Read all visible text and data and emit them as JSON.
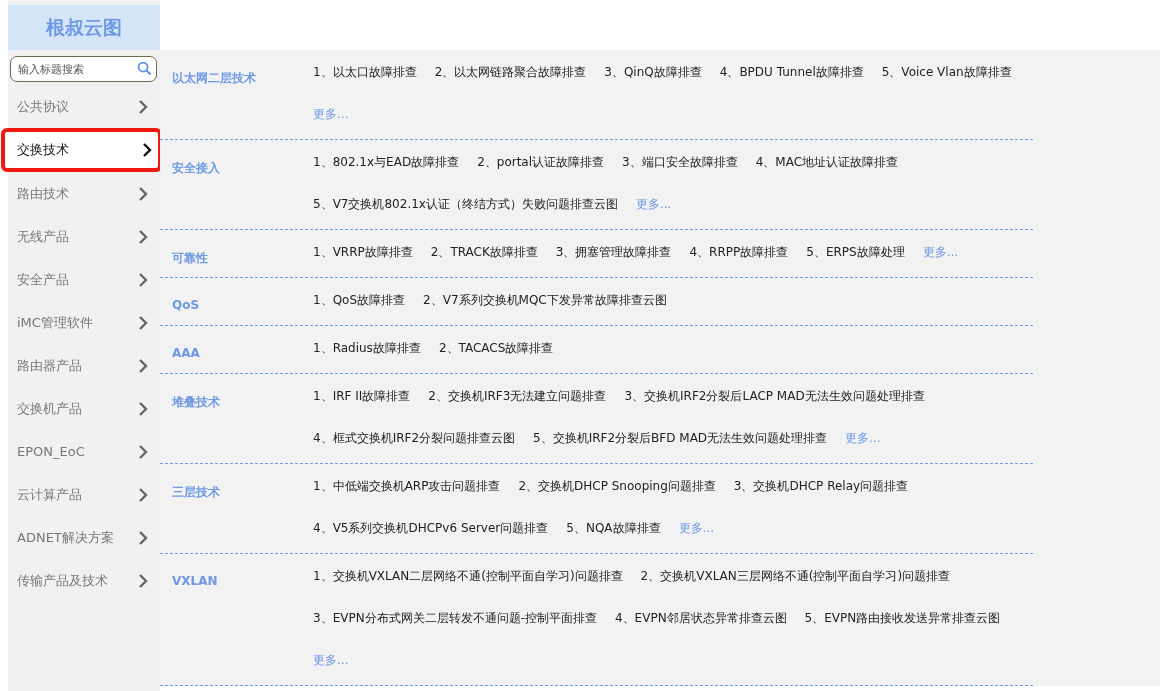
{
  "brand": {
    "title": "根叔云图"
  },
  "search": {
    "placeholder": "输入标题搜索"
  },
  "sidebar": {
    "items": [
      {
        "label": "公共协议",
        "selected": false
      },
      {
        "label": "交换技术",
        "selected": true
      },
      {
        "label": "路由技术",
        "selected": false
      },
      {
        "label": "无线产品",
        "selected": false
      },
      {
        "label": "安全产品",
        "selected": false
      },
      {
        "label": "iMC管理软件",
        "selected": false
      },
      {
        "label": "路由器产品",
        "selected": false
      },
      {
        "label": "交换机产品",
        "selected": false
      },
      {
        "label": "EPON_EoC",
        "selected": false
      },
      {
        "label": "云计算产品",
        "selected": false
      },
      {
        "label": "ADNET解决方案",
        "selected": false
      },
      {
        "label": "传输产品及技术",
        "selected": false
      }
    ]
  },
  "sections": [
    {
      "title": "以太网二层技术",
      "lines": [
        [
          {
            "kind": "article",
            "text": "1、以太口故障排查"
          },
          {
            "kind": "article",
            "text": "2、以太网链路聚合故障排查"
          },
          {
            "kind": "article",
            "text": "3、QinQ故障排查"
          },
          {
            "kind": "article",
            "text": "4、BPDU Tunnel故障排查"
          },
          {
            "kind": "article",
            "text": "5、Voice Vlan故障排查"
          }
        ],
        [
          {
            "kind": "more",
            "text": "更多..."
          }
        ]
      ]
    },
    {
      "title": "安全接入",
      "lines": [
        [
          {
            "kind": "article",
            "text": "1、802.1x与EAD故障排查"
          },
          {
            "kind": "article",
            "text": "2、portal认证故障排查"
          },
          {
            "kind": "article",
            "text": "3、端口安全故障排查"
          },
          {
            "kind": "article",
            "text": "4、MAC地址认证故障排查"
          }
        ],
        [
          {
            "kind": "article",
            "text": "5、V7交换机802.1x认证（终结方式）失败问题排查云图"
          },
          {
            "kind": "more",
            "text": "更多..."
          }
        ]
      ]
    },
    {
      "title": "可靠性",
      "lines": [
        [
          {
            "kind": "article",
            "text": "1、VRRP故障排查"
          },
          {
            "kind": "article",
            "text": "2、TRACK故障排查"
          },
          {
            "kind": "article",
            "text": "3、拥塞管理故障排查"
          },
          {
            "kind": "article",
            "text": "4、RRPP故障排查"
          },
          {
            "kind": "article",
            "text": "5、ERPS故障处理"
          },
          {
            "kind": "more",
            "text": "更多..."
          }
        ]
      ]
    },
    {
      "title": "QoS",
      "lines": [
        [
          {
            "kind": "article",
            "text": "1、QoS故障排查"
          },
          {
            "kind": "article",
            "text": "2、V7系列交换机MQC下发异常故障排查云图"
          }
        ]
      ]
    },
    {
      "title": "AAA",
      "lines": [
        [
          {
            "kind": "article",
            "text": "1、Radius故障排查"
          },
          {
            "kind": "article",
            "text": "2、TACACS故障排查"
          }
        ]
      ]
    },
    {
      "title": "堆叠技术",
      "lines": [
        [
          {
            "kind": "article",
            "text": "1、IRF II故障排查"
          },
          {
            "kind": "article",
            "text": "2、交换机IRF3无法建立问题排查"
          },
          {
            "kind": "article",
            "text": "3、交换机IRF2分裂后LACP MAD无法生效问题处理排查"
          }
        ],
        [
          {
            "kind": "article",
            "text": "4、框式交换机IRF2分裂问题排查云图"
          },
          {
            "kind": "article",
            "text": "5、交换机IRF2分裂后BFD MAD无法生效问题处理排查"
          },
          {
            "kind": "more",
            "text": "更多..."
          }
        ]
      ]
    },
    {
      "title": "三层技术",
      "lines": [
        [
          {
            "kind": "article",
            "text": "1、中低端交换机ARP攻击问题排查"
          },
          {
            "kind": "article",
            "text": "2、交换机DHCP Snooping问题排查"
          },
          {
            "kind": "article",
            "text": "3、交换机DHCP Relay问题排查"
          }
        ],
        [
          {
            "kind": "article",
            "text": "4、V5系列交换机DHCPv6 Server问题排查"
          },
          {
            "kind": "article",
            "text": "5、NQA故障排查"
          },
          {
            "kind": "more",
            "text": "更多..."
          }
        ]
      ]
    },
    {
      "title": "VXLAN",
      "lines": [
        [
          {
            "kind": "article",
            "text": "1、交换机VXLAN二层网络不通(控制平面自学习)问题排查"
          },
          {
            "kind": "article",
            "text": "2、交换机VXLAN三层网络不通(控制平面自学习)问题排查"
          }
        ],
        [
          {
            "kind": "article",
            "text": "3、EVPN分布式网关二层转发不通问题-控制平面排查"
          },
          {
            "kind": "article",
            "text": "4、EVPN邻居状态异常排查云图"
          },
          {
            "kind": "article",
            "text": "5、EVPN路由接收发送异常排查云图"
          }
        ],
        [
          {
            "kind": "more",
            "text": "更多..."
          }
        ]
      ]
    }
  ]
}
